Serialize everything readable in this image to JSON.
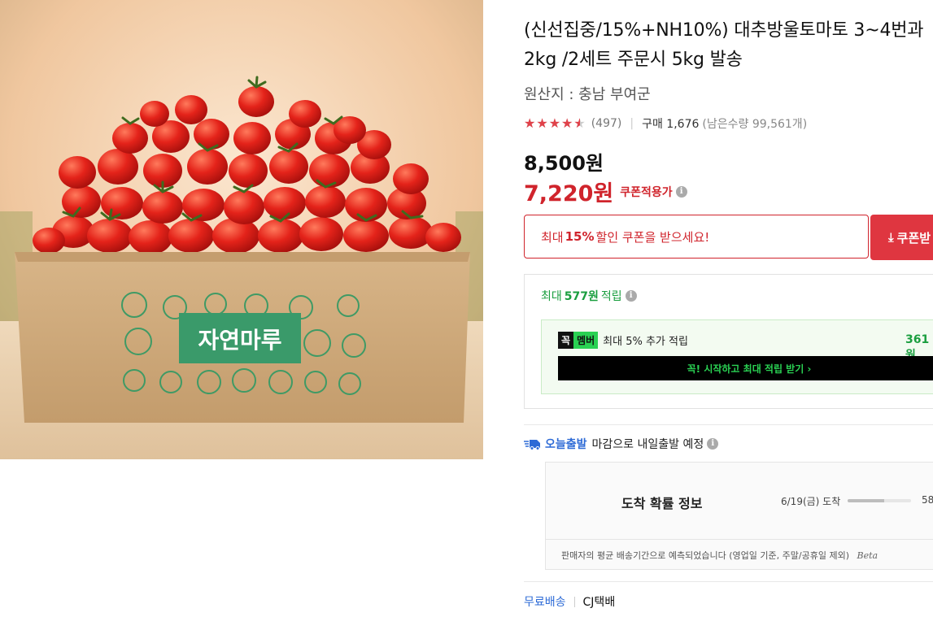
{
  "product": {
    "title": "(신선집중/15%+NH10%) 대추방울토마토 3~4번과 2kg /2세트 주문시 5kg 발송",
    "origin": "원산지 : 충남 부여군",
    "image_brand_text": "자연마루"
  },
  "rating": {
    "stars": 4.5,
    "count": "(497)",
    "purchase_label": "구매 1,676",
    "stock": "(남은수량 99,561개)"
  },
  "price": {
    "original": "8,500원",
    "coupon": "7,220원",
    "coupon_tag": "쿠폰적용가"
  },
  "coupon": {
    "text_before": "최대",
    "percent": "15%",
    "text_after": "할인 쿠폰을 받으세요!",
    "button": "쿠폰받"
  },
  "points": {
    "prefix": "최대",
    "amount": "577원",
    "suffix": "적립",
    "member_badge_1": "꼭",
    "member_badge_2": "멤버",
    "member_text": "최대 5% 추가 적립",
    "member_amount": "361원",
    "member_button": "꼭! 시작하고 최대 적립 받기 ›"
  },
  "delivery": {
    "brand": "오늘출발",
    "text": "마감으로 내일출발 예정",
    "arrival_title": "도착 확률 정보",
    "arrival_date": "6/19(금) 도착",
    "arrival_bar_fraction": 0.58,
    "arrival_pct": "58",
    "arrival_note": "판매자의 평균 배송기간으로 예측되었습니다 (영업일 기준, 주말/공휴일 제외)",
    "beta": "Beta"
  },
  "shipping": {
    "free": "무료배송",
    "carrier": "CJ택배"
  },
  "colors": {
    "accent_red": "#d0242c",
    "coupon_button": "#df3640",
    "points_green": "#1a9e3f",
    "link_blue": "#2e6bd6"
  }
}
